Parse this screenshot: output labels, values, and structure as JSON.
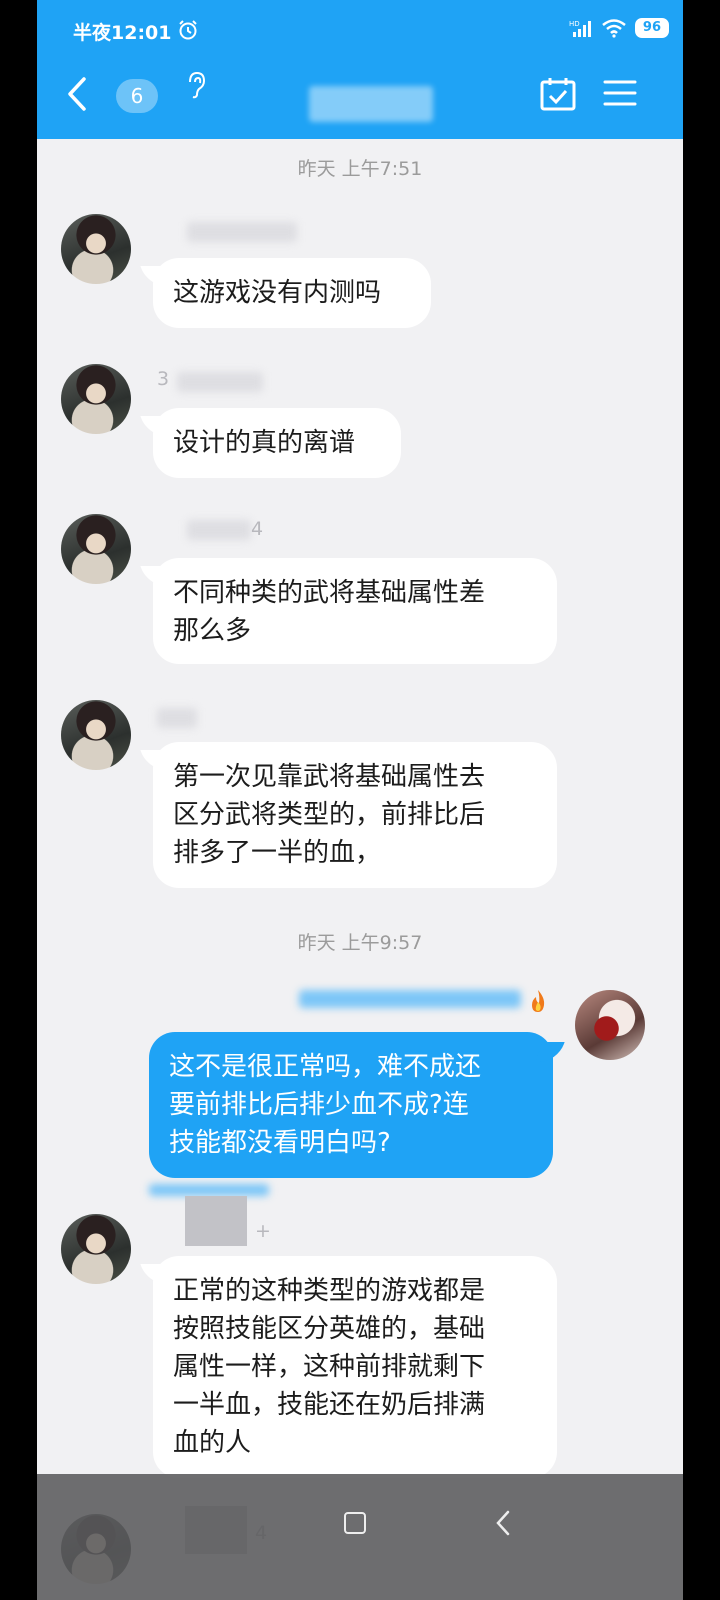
{
  "status_bar": {
    "time": "半夜12:01",
    "signal": "HD",
    "battery": "96"
  },
  "header": {
    "unread_count": "6"
  },
  "chat": {
    "timestamps": [
      "昨天 上午7:51",
      "昨天 上午9:57"
    ],
    "messages": [
      {
        "nick_tail": "",
        "text": "这游戏没有内测吗"
      },
      {
        "nick_tail": "3",
        "text": "设计的真的离谱"
      },
      {
        "nick_tail": "4",
        "text": "不同种类的武将基础属性差\n那么多"
      },
      {
        "nick_tail": "",
        "text": "第一次见靠武将基础属性去\n区分武将类型的，前排比后\n排多了一半的血，"
      },
      {
        "nick_tail": "",
        "text": "这不是很正常吗，难不成还\n要前排比后排少血不成?连\n技能都没看明白吗?"
      },
      {
        "nick_tail": "+",
        "text": "正常的这种类型的游戏都是\n按照技能区分英雄的，基础\n属性一样，这种前排就剩下\n一半血，技能还在奶后排满\n血的人"
      },
      {
        "nick_tail": "4",
        "text": ""
      }
    ]
  },
  "colors": {
    "accent": "#1fa3f5",
    "background": "#f1f1f3",
    "bubble": "#ffffff"
  }
}
